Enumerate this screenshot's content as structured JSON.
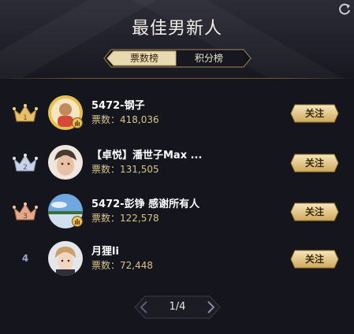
{
  "header": {
    "title": "最佳男新人",
    "refresh_icon": "refresh-icon"
  },
  "tabs": [
    {
      "label": "票数榜",
      "active": true
    },
    {
      "label": "积分榜",
      "active": false
    }
  ],
  "ranking": [
    {
      "rank": "1",
      "rank_style": "gold-crown",
      "name": "5472-钢子",
      "votes_label": "票数：",
      "votes": "418,036",
      "follow_label": "关注",
      "has_badge": true
    },
    {
      "rank": "2",
      "rank_style": "silver-crown",
      "name": "【卓悦】潘世子Max ...",
      "votes_label": "票数：",
      "votes": "131,505",
      "follow_label": "关注",
      "has_badge": false
    },
    {
      "rank": "3",
      "rank_style": "bronze-crown",
      "name": "5472-彭铮 感谢所有人",
      "votes_label": "票数：",
      "votes": "122,578",
      "follow_label": "关注",
      "has_badge": true
    },
    {
      "rank": "4",
      "rank_style": "number",
      "name": "月狸li",
      "votes_label": "票数：",
      "votes": "72,448",
      "follow_label": "关注",
      "has_badge": false
    }
  ],
  "pagination": {
    "text": "1/4",
    "prev_icon": "chevron-left-icon",
    "next_icon": "chevron-right-icon"
  },
  "colors": {
    "background": "#14151d",
    "gold": "#d8c48a",
    "accent_gold": "#e8c460"
  }
}
